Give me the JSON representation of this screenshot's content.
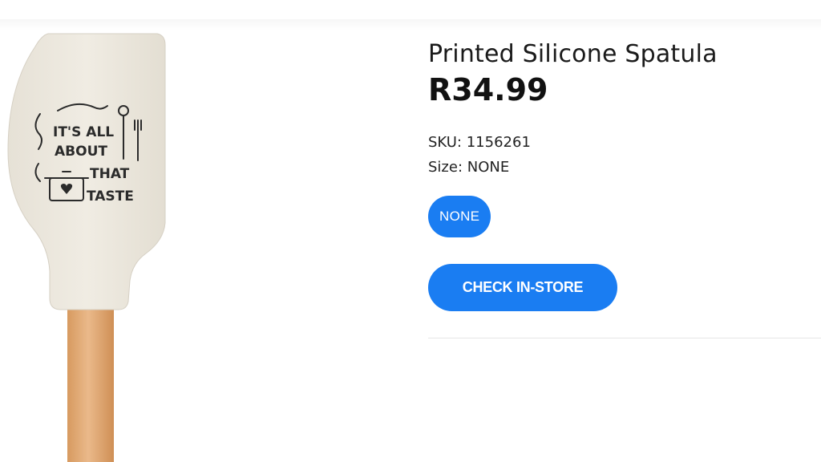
{
  "product": {
    "title": "Printed Silicone Spatula",
    "price": "R34.99",
    "sku_label": "SKU:",
    "sku_value": "1156261",
    "size_label": "Size:",
    "size_value": "NONE"
  },
  "image": {
    "print_lines": [
      "IT'S ALL",
      "ABOUT",
      "THAT",
      "TASTE"
    ],
    "head_color": "#ece8de",
    "handle_color": "#e2ad78",
    "ink_color": "#2b2b2b"
  },
  "size_options": [
    {
      "label": "NONE",
      "selected": true
    }
  ],
  "actions": {
    "check_in_store": "CHECK IN-STORE"
  },
  "colors": {
    "accent": "#1a7df2"
  }
}
